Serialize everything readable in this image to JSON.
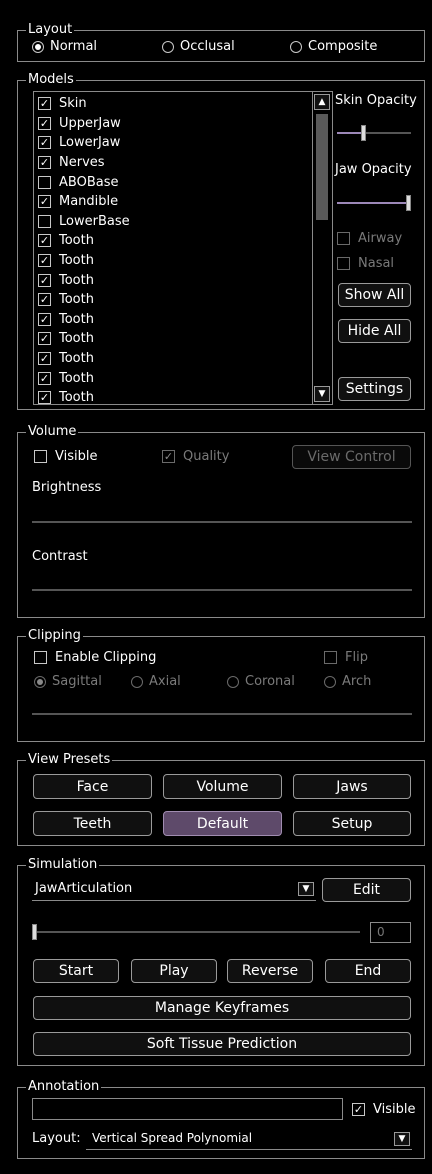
{
  "layout": {
    "title": "Layout",
    "options": [
      "Normal",
      "Occlusal",
      "Composite"
    ],
    "selected": "Normal"
  },
  "models": {
    "title": "Models",
    "items": [
      {
        "label": "Skin",
        "checked": true
      },
      {
        "label": "UpperJaw",
        "checked": true
      },
      {
        "label": "LowerJaw",
        "checked": true
      },
      {
        "label": "Nerves",
        "checked": true
      },
      {
        "label": "ABOBase",
        "checked": false
      },
      {
        "label": "Mandible",
        "checked": true
      },
      {
        "label": "LowerBase",
        "checked": false
      },
      {
        "label": "Tooth",
        "checked": true
      },
      {
        "label": "Tooth",
        "checked": true
      },
      {
        "label": "Tooth",
        "checked": true
      },
      {
        "label": "Tooth",
        "checked": true
      },
      {
        "label": "Tooth",
        "checked": true
      },
      {
        "label": "Tooth",
        "checked": true
      },
      {
        "label": "Tooth",
        "checked": true
      },
      {
        "label": "Tooth",
        "checked": true
      },
      {
        "label": "Tooth",
        "checked": true
      }
    ],
    "skin_opacity_label": "Skin Opacity",
    "skin_opacity_value": 0.35,
    "jaw_opacity_label": "Jaw Opacity",
    "jaw_opacity_value": 1.0,
    "airway_label": "Airway",
    "nasal_label": "Nasal",
    "show_all_label": "Show All",
    "hide_all_label": "Hide All",
    "settings_label": "Settings"
  },
  "volume": {
    "title": "Volume",
    "visible_label": "Visible",
    "quality_label": "Quality",
    "view_control_label": "View Control",
    "brightness_label": "Brightness",
    "contrast_label": "Contrast"
  },
  "clipping": {
    "title": "Clipping",
    "enable_label": "Enable Clipping",
    "flip_label": "Flip",
    "planes": [
      "Sagittal",
      "Axial",
      "Coronal",
      "Arch"
    ],
    "selected": "Sagittal"
  },
  "view_presets": {
    "title": "View Presets",
    "buttons": [
      "Face",
      "Volume",
      "Jaws",
      "Teeth",
      "Default",
      "Setup"
    ],
    "active": "Default"
  },
  "simulation": {
    "title": "Simulation",
    "selected": "JawArticulation",
    "edit_label": "Edit",
    "frame_value": "0",
    "start_label": "Start",
    "play_label": "Play",
    "reverse_label": "Reverse",
    "end_label": "End",
    "manage_keyframes_label": "Manage Keyframes",
    "soft_tissue_label": "Soft Tissue Prediction"
  },
  "annotation": {
    "title": "Annotation",
    "text_value": "",
    "visible_label": "Visible",
    "layout_label": "Layout:",
    "layout_value": "Vertical Spread Polynomial"
  },
  "icons": {
    "check": "✓",
    "arrow_up": "▲",
    "arrow_down": "▼"
  },
  "colors": {
    "background": "#000000",
    "border": "#8a8a8a",
    "active_preset": "#5e4a6a",
    "jaw_slider": "#9c88b8"
  }
}
